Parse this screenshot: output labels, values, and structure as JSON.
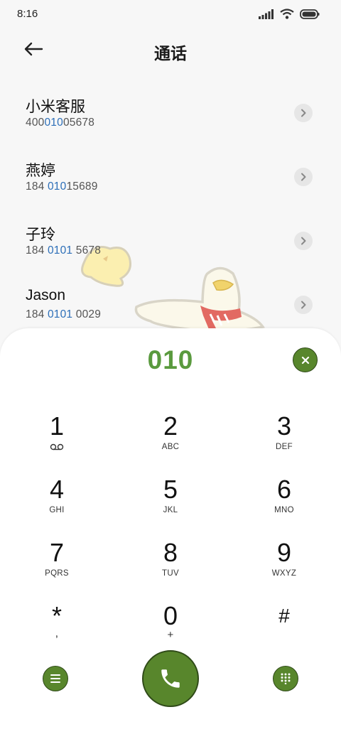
{
  "status": {
    "time": "8:16"
  },
  "header": {
    "title": "通话"
  },
  "results": [
    {
      "name": "小米客服",
      "num_pre": "400",
      "num_hl": "010",
      "num_post": "05678"
    },
    {
      "name": "燕婷",
      "num_pre": "184 ",
      "num_hl": "010",
      "num_post": "15689"
    },
    {
      "name": "子玲",
      "num_pre": "184 ",
      "num_hl": "0101",
      "num_post": " 5678"
    },
    {
      "name": "Jason",
      "num_pre": "184 ",
      "num_hl": "0101",
      "num_post": " 0029"
    }
  ],
  "dialpad": {
    "input": "010",
    "keys": [
      {
        "digit": "1",
        "letters": ""
      },
      {
        "digit": "2",
        "letters": "ABC"
      },
      {
        "digit": "3",
        "letters": "DEF"
      },
      {
        "digit": "4",
        "letters": "GHI"
      },
      {
        "digit": "5",
        "letters": "JKL"
      },
      {
        "digit": "6",
        "letters": "MNO"
      },
      {
        "digit": "7",
        "letters": "PQRS"
      },
      {
        "digit": "8",
        "letters": "TUV"
      },
      {
        "digit": "9",
        "letters": "WXYZ"
      },
      {
        "digit": "*",
        "letters": ","
      },
      {
        "digit": "0",
        "letters": "+"
      },
      {
        "digit": "#",
        "letters": ""
      }
    ]
  },
  "icons": {
    "voicemail": "voicemail-icon",
    "menu": "menu-icon",
    "call": "phone-icon",
    "keypad": "keypad-icon",
    "clear": "close-icon"
  },
  "colors": {
    "accent": "#58862c",
    "dialed_text": "#5a9a3e",
    "highlight": "#2d6fb8"
  }
}
